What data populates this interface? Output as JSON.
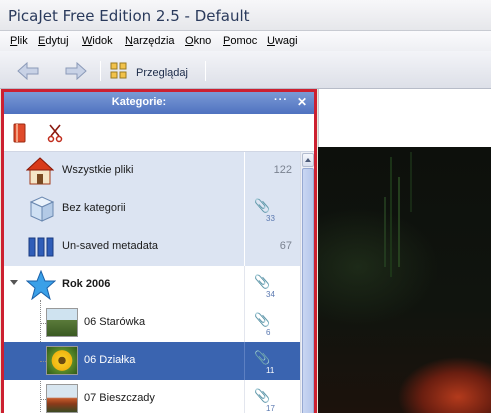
{
  "window": {
    "title": "PicaJet Free Edition 2.5 - Default"
  },
  "menu": [
    "Plik",
    "Edytuj",
    "Widok",
    "Narzędzia",
    "Okno",
    "Pomoc",
    "Uwagi"
  ],
  "toolbar": {
    "browse_label": "Przeglądaj"
  },
  "categories_panel": {
    "title": "Kategorie:",
    "options_label": "···",
    "close_label": "✕",
    "rows": [
      {
        "label": "Wszystkie pliki",
        "count": "122"
      },
      {
        "label": "Bez kategorii",
        "count": "33"
      },
      {
        "label": "Un-saved metadata",
        "count": "67"
      },
      {
        "label": "Rok 2006",
        "count": "34"
      },
      {
        "label": "06 Starówka",
        "count": "6"
      },
      {
        "label": "06 Działka",
        "count": "11"
      },
      {
        "label": "07 Bieszczady",
        "count": "17"
      }
    ]
  },
  "colors": {
    "accent": "#3a64b0",
    "panel_border": "#cc2030",
    "header": "#5a7cc6"
  }
}
